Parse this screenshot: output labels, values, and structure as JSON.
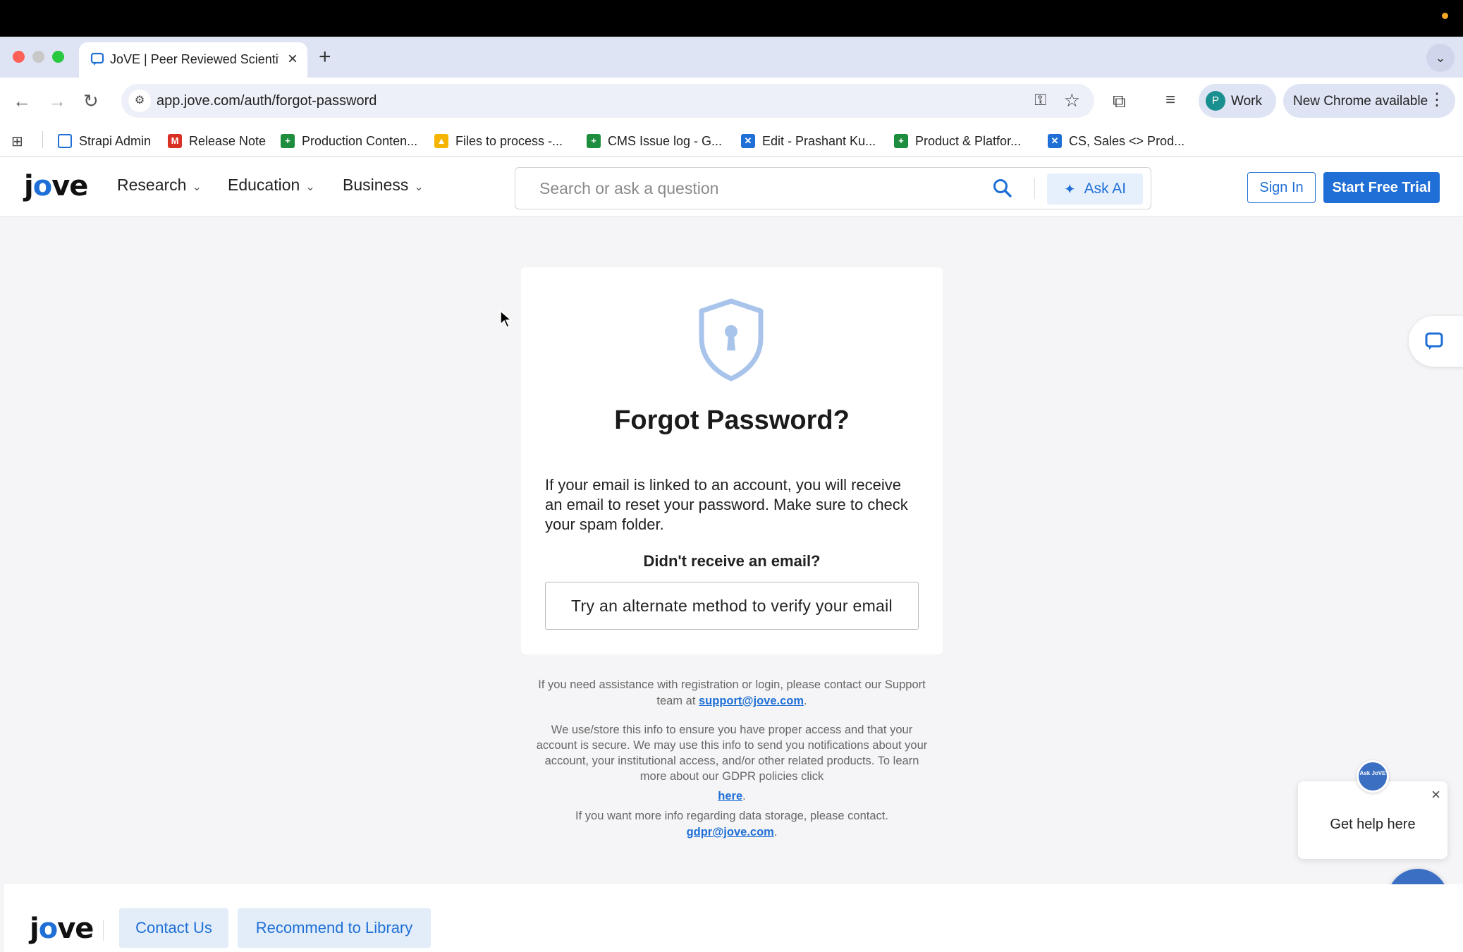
{
  "browser": {
    "tab_title": "JoVE | Peer Reviewed Scientific",
    "url": "app.jove.com/auth/forgot-password",
    "profile_initial": "P",
    "profile_name": "Work",
    "update_label": "New Chrome available"
  },
  "bookmarks": [
    {
      "label": "Strapi Admin",
      "icon": "chat-icon",
      "color": "#1f6fd6"
    },
    {
      "label": "Release Note",
      "icon": "gmail-icon",
      "color": "#d93025"
    },
    {
      "label": "Production Conten...",
      "icon": "sheets-icon",
      "color": "#1e8e3e"
    },
    {
      "label": "Files to process -...",
      "icon": "drive-icon",
      "color": "#f4b400"
    },
    {
      "label": "CMS Issue log - G...",
      "icon": "sheets-icon",
      "color": "#1e8e3e"
    },
    {
      "label": "Edit - Prashant Ku...",
      "icon": "confluence-icon",
      "color": "#1f6fd6"
    },
    {
      "label": "Product & Platfor...",
      "icon": "sheets-icon",
      "color": "#1e8e3e"
    },
    {
      "label": "CS, Sales <> Prod...",
      "icon": "confluence-icon",
      "color": "#1f6fd6"
    }
  ],
  "header": {
    "logo_j": "j",
    "logo_o": "o",
    "logo_rest": "ve",
    "nav": [
      "Research",
      "Education",
      "Business"
    ],
    "search_placeholder": "Search or ask a question",
    "ask_ai": "Ask AI",
    "sign_in": "Sign In",
    "start_trial": "Start Free Trial"
  },
  "card": {
    "title": "Forgot Password?",
    "description": "If your email is linked to an account, you will receive an email to reset your password. Make sure to check your spam folder.",
    "didnt_receive": "Didn't receive an email?",
    "alternate_button": "Try an alternate method to verify your email"
  },
  "info": {
    "assist_text": "If you need assistance with registration or login, please contact our Support team at",
    "support_email": "support@jove.com",
    "gdpr_text": "We use/store this info to ensure you have proper access and that your account is secure. We may use this info to send you notifications about your account, your institutional access, and/or other related products. To learn more about our GDPR policies click",
    "gdpr_link": "here",
    "storage_text": "If you want more info regarding data storage, please contact.",
    "gdpr_email": "gdpr@jove.com"
  },
  "help": {
    "ask_jove": "Ask JoVE",
    "get_help": "Get help here"
  },
  "footer": {
    "contact": "Contact Us",
    "recommend": "Recommend to Library"
  },
  "colors": {
    "brand": "#1f6fd6",
    "shield": "#a9c4ea"
  }
}
